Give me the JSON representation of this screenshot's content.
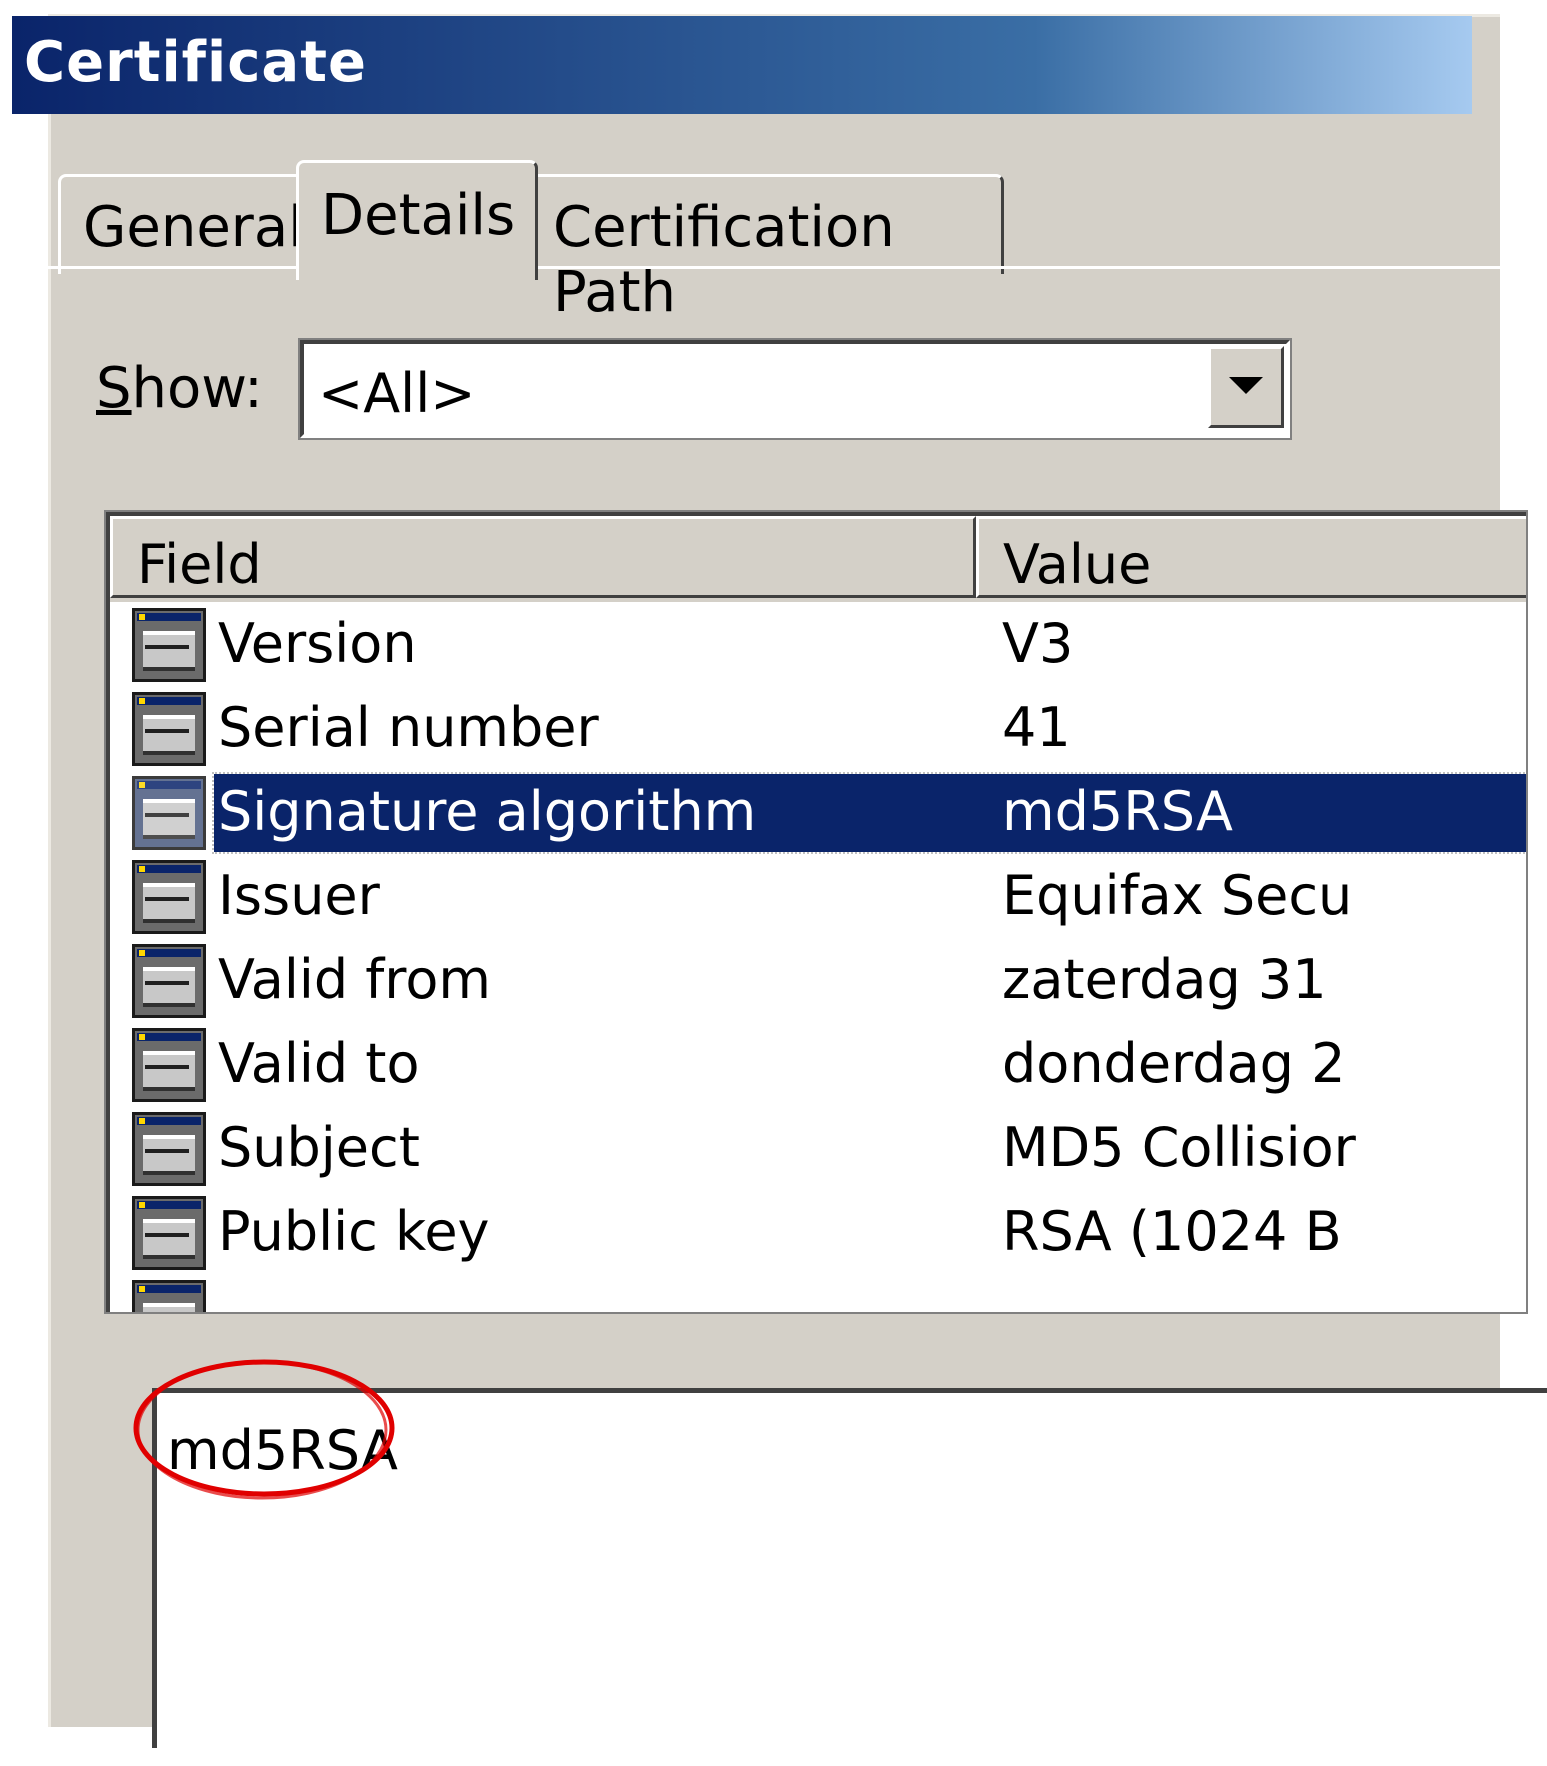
{
  "window": {
    "title": "Certificate"
  },
  "tabs": [
    {
      "label": "General",
      "active": false
    },
    {
      "label": "Details",
      "active": true
    },
    {
      "label": "Certification Path",
      "active": false
    }
  ],
  "show": {
    "label_first": "S",
    "label_rest": "how:",
    "selected": "<All>"
  },
  "listview": {
    "columns": [
      "Field",
      "Value"
    ],
    "rows": [
      {
        "field": "Version",
        "value": "V3",
        "icon": "certificate-field-icon"
      },
      {
        "field": "Serial number",
        "value": "41",
        "icon": "certificate-field-icon"
      },
      {
        "field": "Signature algorithm",
        "value": "md5RSA",
        "icon": "certificate-field-icon",
        "selected": true
      },
      {
        "field": "Issuer",
        "value": "Equifax Secu",
        "icon": "certificate-field-icon"
      },
      {
        "field": "Valid from",
        "value": "zaterdag 31",
        "icon": "certificate-field-icon"
      },
      {
        "field": "Valid to",
        "value": "donderdag 2",
        "icon": "certificate-field-icon"
      },
      {
        "field": "Subject",
        "value": "MD5 Collisior",
        "icon": "certificate-field-icon"
      },
      {
        "field": "Public key",
        "value": "RSA (1024 B",
        "icon": "certificate-field-icon"
      }
    ]
  },
  "detail": {
    "text": "md5RSA"
  },
  "colors": {
    "title_bar_start": "#0a246a",
    "title_bar_end": "#a6caf0",
    "selection": "#0a246a",
    "annotation": "#e00000"
  }
}
